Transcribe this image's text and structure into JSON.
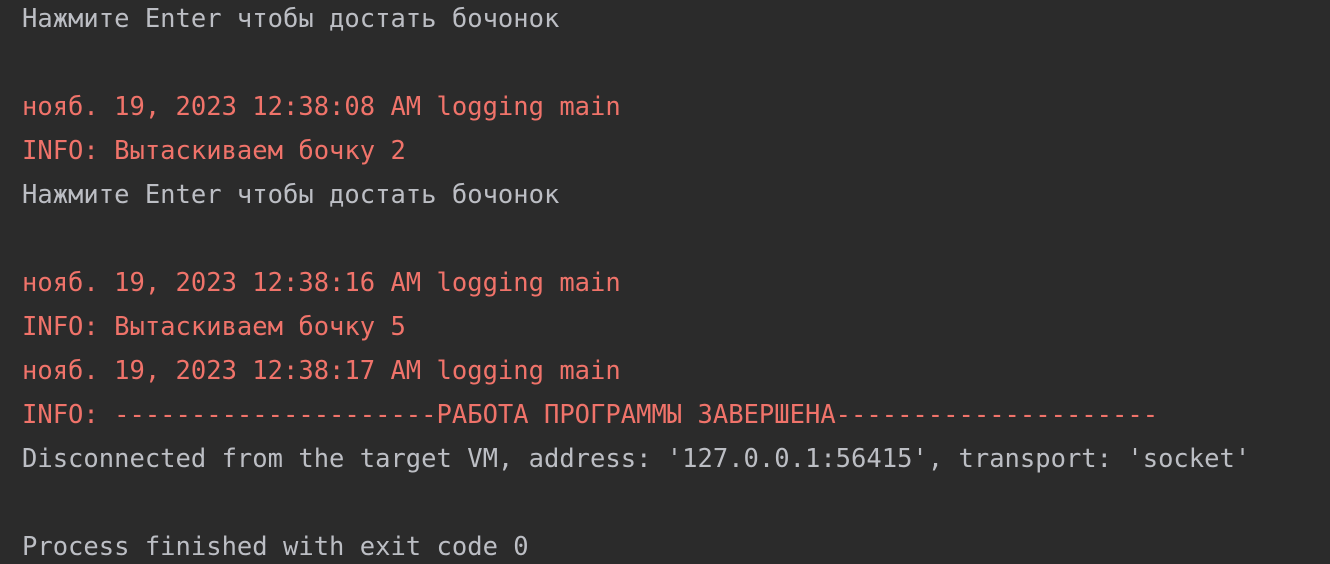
{
  "console": {
    "lines": [
      {
        "text": "Нажмите Enter чтобы достать бочонок",
        "kind": "stdout"
      },
      {
        "text": "",
        "kind": "blank"
      },
      {
        "text": "нояб. 19, 2023 12:38:08 AM logging main",
        "kind": "stderr"
      },
      {
        "text": "INFO: Вытаскиваем бочку 2",
        "kind": "stderr"
      },
      {
        "text": "Нажмите Enter чтобы достать бочонок",
        "kind": "stdout"
      },
      {
        "text": "",
        "kind": "blank"
      },
      {
        "text": "нояб. 19, 2023 12:38:16 AM logging main",
        "kind": "stderr"
      },
      {
        "text": "INFO: Вытаскиваем бочку 5",
        "kind": "stderr"
      },
      {
        "text": "нояб. 19, 2023 12:38:17 AM logging main",
        "kind": "stderr"
      },
      {
        "text": "INFO: ---------------------РАБОТА ПРОГРАММЫ ЗАВЕРШЕНА---------------------",
        "kind": "stderr"
      },
      {
        "text": "Disconnected from the target VM, address: '127.0.0.1:56415', transport: 'socket'",
        "kind": "stdout"
      },
      {
        "text": "",
        "kind": "blank"
      },
      {
        "text": "Process finished with exit code 0",
        "kind": "stdout"
      }
    ]
  },
  "colors": {
    "background": "#2b2b2b",
    "stdout": "#bcbec4",
    "stderr": "#f0736a"
  }
}
